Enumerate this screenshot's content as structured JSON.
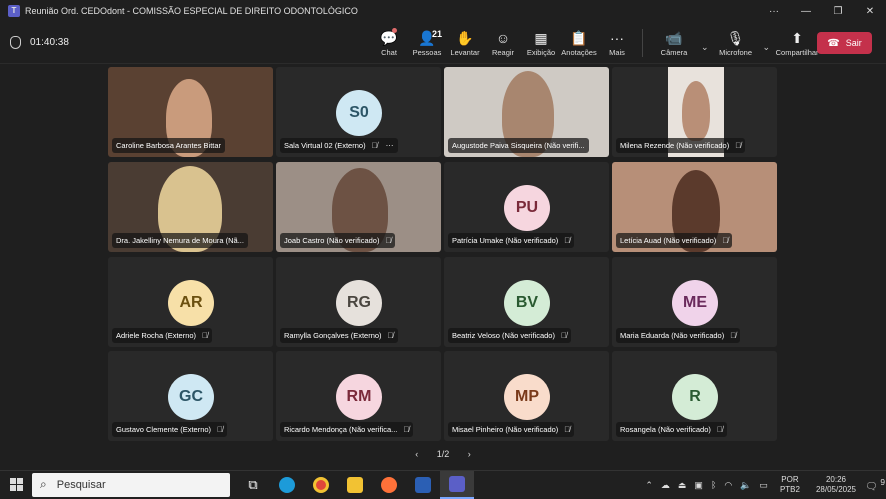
{
  "window": {
    "title": "Reunião Ord. CEDOdont - COMISSÃO ESPECIAL DE DIREITO ODONTOLÓGICO",
    "more": "···",
    "minimize": "—",
    "restore": "❐",
    "close": "✕"
  },
  "toolbar": {
    "timer": "01:40:38",
    "chat": "Chat",
    "people": "Pessoas",
    "people_count": "21",
    "raise_hand": "Levantar",
    "react": "Reagir",
    "view": "Exibição",
    "notes": "Anotações",
    "more": "Mais",
    "camera": "Câmera",
    "mic": "Microfone",
    "share": "Compartilhar",
    "leave": "Sair"
  },
  "tiles": [
    {
      "name": "Caroline Barbosa Arantes Bittar",
      "video": true
    },
    {
      "name": "Sala Virtual 02 (Externo)",
      "initials": "S0",
      "avatar_color": "#cfe8f3",
      "avatar_text_color": "#2c5566"
    },
    {
      "name": "Augustode Paiva Sisqueira (Não verifi...",
      "video": true
    },
    {
      "name": "Milena Rezende (Não verificado)",
      "video": true
    },
    {
      "name": "Dra. Jakelliny Nemura de Moura (Nã...",
      "video": true
    },
    {
      "name": "Joab Castro (Não verificado)",
      "video": true
    },
    {
      "name": "Patrícia Umake (Não verificado)",
      "initials": "PU",
      "avatar_color": "#f6d6df",
      "avatar_text_color": "#7a2a3a"
    },
    {
      "name": "Letícia Auad (Não verificado)",
      "video": true
    },
    {
      "name": "Adriele Rocha (Externo)",
      "initials": "AR",
      "avatar_color": "#f7e0a8",
      "avatar_text_color": "#6b5010"
    },
    {
      "name": "Ramylla Gonçalves (Externo)",
      "initials": "RG",
      "avatar_color": "#e6e1dc",
      "avatar_text_color": "#4a4640"
    },
    {
      "name": "Beatriz Veloso (Não verificado)",
      "initials": "BV",
      "avatar_color": "#d4ecd6",
      "avatar_text_color": "#2a5a31"
    },
    {
      "name": "Maria Eduarda (Não verificado)",
      "initials": "ME",
      "avatar_color": "#f0d3ea",
      "avatar_text_color": "#6a2a5c"
    },
    {
      "name": "Gustavo Clemente (Externo)",
      "initials": "GC",
      "avatar_color": "#cfe8f3",
      "avatar_text_color": "#2c5566"
    },
    {
      "name": "Ricardo Mendonça (Não verifica...",
      "initials": "RM",
      "avatar_color": "#f6d6df",
      "avatar_text_color": "#7a2a3a"
    },
    {
      "name": "Misael Pinheiro (Não verificado)",
      "initials": "MP",
      "avatar_color": "#f9dccb",
      "avatar_text_color": "#7a3a1a"
    },
    {
      "name": "Rosangela (Não verificado)",
      "initials": "R",
      "avatar_color": "#d4ecd6",
      "avatar_text_color": "#2a5a31"
    }
  ],
  "pager": {
    "label": "1/2",
    "prev": "‹",
    "next": "›"
  },
  "taskbar": {
    "search_placeholder": "Pesquisar",
    "lang_top": "POR",
    "lang_bottom": "PTB2",
    "time": "20:26",
    "date": "28/05/2025",
    "notification_count": "9"
  }
}
